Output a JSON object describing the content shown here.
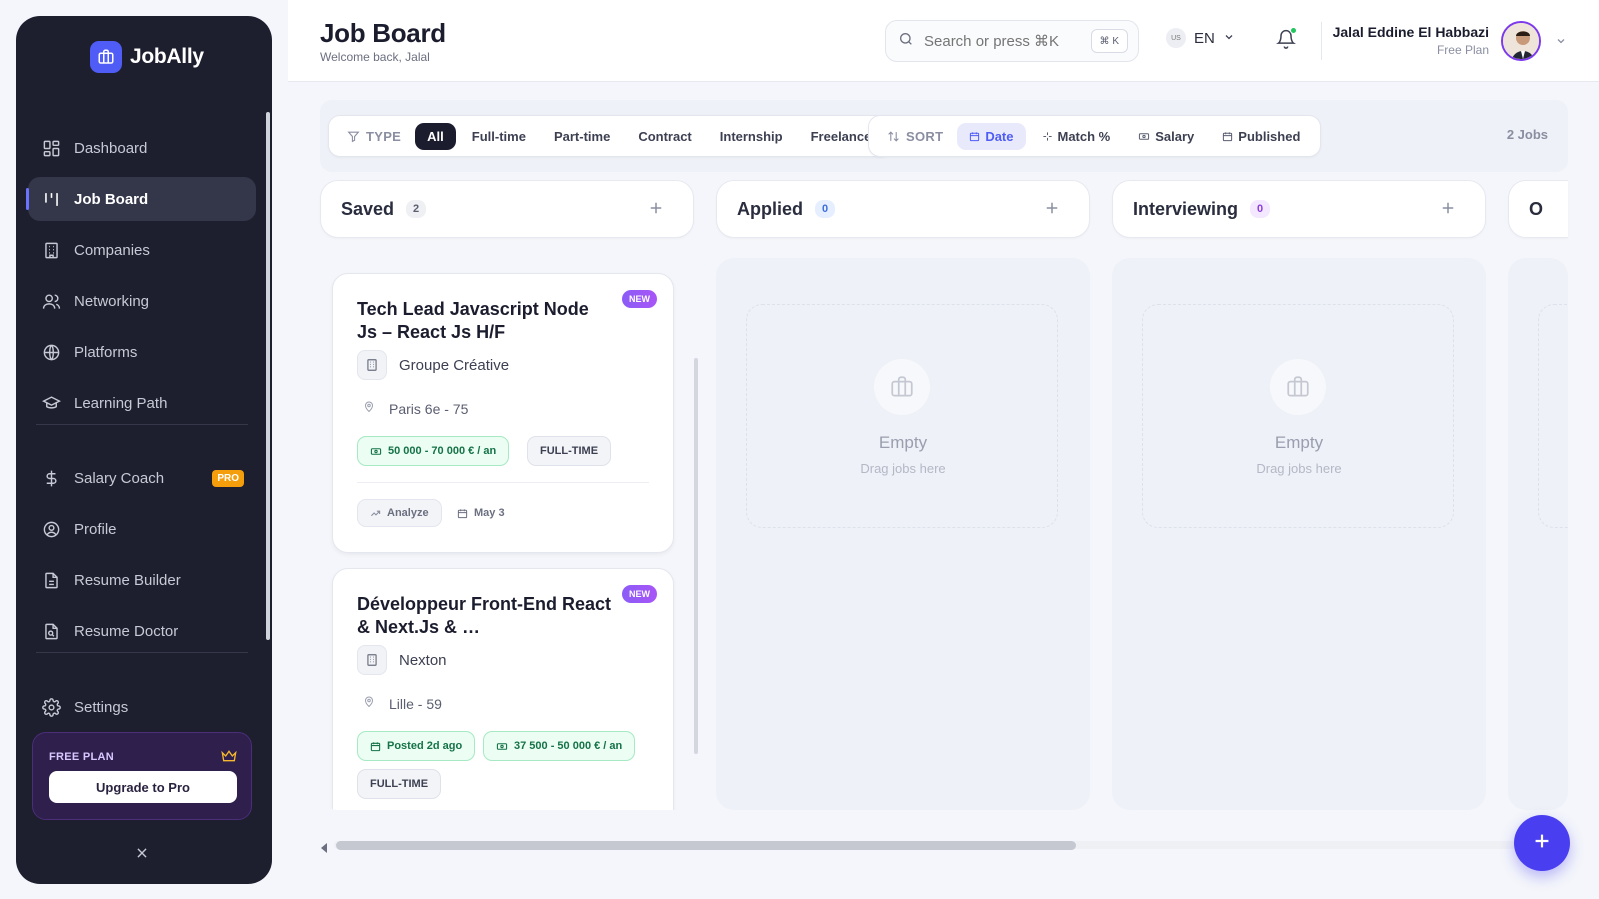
{
  "brand": {
    "name": "JobAlly"
  },
  "sidebar": {
    "items": [
      {
        "label": "Dashboard",
        "icon": "grid-icon"
      },
      {
        "label": "Job Board",
        "icon": "board-icon",
        "active": true
      },
      {
        "label": "Companies",
        "icon": "building-icon"
      },
      {
        "label": "Networking",
        "icon": "users-icon"
      },
      {
        "label": "Platforms",
        "icon": "globe-icon"
      },
      {
        "label": "Learning Path",
        "icon": "graduation-cap-icon"
      },
      {
        "label": "Salary Coach",
        "icon": "dollar-icon",
        "badge": "PRO"
      },
      {
        "label": "Profile",
        "icon": "user-circle-icon"
      },
      {
        "label": "Resume Builder",
        "icon": "file-text-icon"
      },
      {
        "label": "Resume Doctor",
        "icon": "file-search-icon"
      },
      {
        "label": "Settings",
        "icon": "gear-icon"
      }
    ],
    "plan": {
      "label": "FREE PLAN",
      "button": "Upgrade to Pro"
    }
  },
  "header": {
    "title": "Job Board",
    "subtitle": "Welcome back, Jalal",
    "search": {
      "placeholder": "Search or press ⌘K",
      "shortcut": "⌘ K"
    },
    "language": {
      "flag": "US",
      "code": "EN"
    },
    "user": {
      "name": "Jalal Eddine El Habbazi",
      "plan": "Free Plan"
    }
  },
  "toolbar": {
    "type_label": "TYPE",
    "type_filters": [
      "All",
      "Full-time",
      "Part-time",
      "Contract",
      "Internship",
      "Freelance"
    ],
    "type_selected": "All",
    "sort_label": "SORT",
    "sort_options": [
      "Date",
      "Match %",
      "Salary",
      "Published"
    ],
    "sort_selected": "Date",
    "jobs_count": "2 Jobs"
  },
  "columns": [
    {
      "title": "Saved",
      "count": "2",
      "count_bg": "#eef0f4",
      "count_color": "#5a5e70"
    },
    {
      "title": "Applied",
      "count": "0",
      "count_bg": "#e6efff",
      "count_color": "#3b6fd8"
    },
    {
      "title": "Interviewing",
      "count": "0",
      "count_bg": "#f3e8ff",
      "count_color": "#8b3fd9"
    },
    {
      "title": "O",
      "count": "",
      "count_bg": "#ffffff",
      "count_color": "#ffffff"
    }
  ],
  "empty_state": {
    "title": "Empty",
    "subtitle": "Drag jobs here"
  },
  "cards": [
    {
      "title": "Tech Lead Javascript Node Js – React Js H/F",
      "badge": "NEW",
      "company": "Groupe Créative",
      "location": "Paris 6e - 75",
      "salary": "50 000 - 70 000 € / an",
      "type": "FULL-TIME",
      "analyze": "Analyze",
      "date": "May 3"
    },
    {
      "title": "Développeur Front-End React & Next.Js & …",
      "badge": "NEW",
      "company": "Nexton",
      "location": "Lille - 59",
      "posted": "Posted 2d ago",
      "salary": "37 500 - 50 000 € / an",
      "type": "FULL-TIME"
    }
  ]
}
